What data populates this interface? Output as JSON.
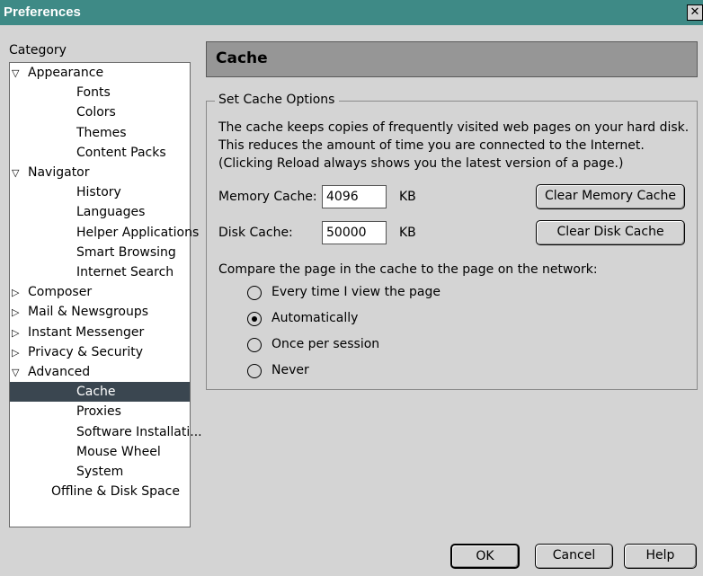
{
  "window": {
    "title": "Preferences",
    "close_glyph": "✕"
  },
  "category_label": "Category",
  "tree": [
    {
      "label": "Appearance",
      "toggle": "▽",
      "level": 0
    },
    {
      "label": "Fonts",
      "level": 1
    },
    {
      "label": "Colors",
      "level": 1
    },
    {
      "label": "Themes",
      "level": 1
    },
    {
      "label": "Content Packs",
      "level": 1
    },
    {
      "label": "Navigator",
      "toggle": "▽",
      "level": 0
    },
    {
      "label": "History",
      "level": 1
    },
    {
      "label": "Languages",
      "level": 1
    },
    {
      "label": "Helper Applications",
      "level": 1
    },
    {
      "label": "Smart Browsing",
      "level": 1
    },
    {
      "label": "Internet Search",
      "level": 1
    },
    {
      "label": "Composer",
      "toggle": "▷",
      "level": 0
    },
    {
      "label": "Mail & Newsgroups",
      "toggle": "▷",
      "level": 0
    },
    {
      "label": "Instant Messenger",
      "toggle": "▷",
      "level": 0
    },
    {
      "label": "Privacy & Security",
      "toggle": "▷",
      "level": 0
    },
    {
      "label": "Advanced",
      "toggle": "▽",
      "level": 0
    },
    {
      "label": "Cache",
      "level": 1,
      "selected": true
    },
    {
      "label": "Proxies",
      "level": 1
    },
    {
      "label": "Software Installati...",
      "level": 1
    },
    {
      "label": "Mouse Wheel",
      "level": 1
    },
    {
      "label": "System",
      "level": 1
    },
    {
      "label": "Offline & Disk Space",
      "level": 2
    }
  ],
  "panel": {
    "title": "Cache",
    "group_label": "Set Cache Options",
    "description": "The cache keeps copies of frequently visited web pages on your hard disk. This reduces the amount of time you are connected to the Internet. (Clicking Reload always shows you the latest version of a page.)",
    "memory_cache": {
      "label": "Memory Cache:",
      "value": "4096",
      "unit": "KB",
      "button": "Clear Memory Cache"
    },
    "disk_cache": {
      "label": "Disk Cache:",
      "value": "50000",
      "unit": "KB",
      "button": "Clear Disk Cache"
    },
    "compare_label": "Compare the page in the cache to the page on the network:",
    "options": [
      {
        "label": "Every time I view the page",
        "checked": false
      },
      {
        "label": "Automatically",
        "checked": true
      },
      {
        "label": "Once per session",
        "checked": false
      },
      {
        "label": "Never",
        "checked": false
      }
    ]
  },
  "buttons": {
    "ok": "OK",
    "cancel": "Cancel",
    "help": "Help"
  }
}
